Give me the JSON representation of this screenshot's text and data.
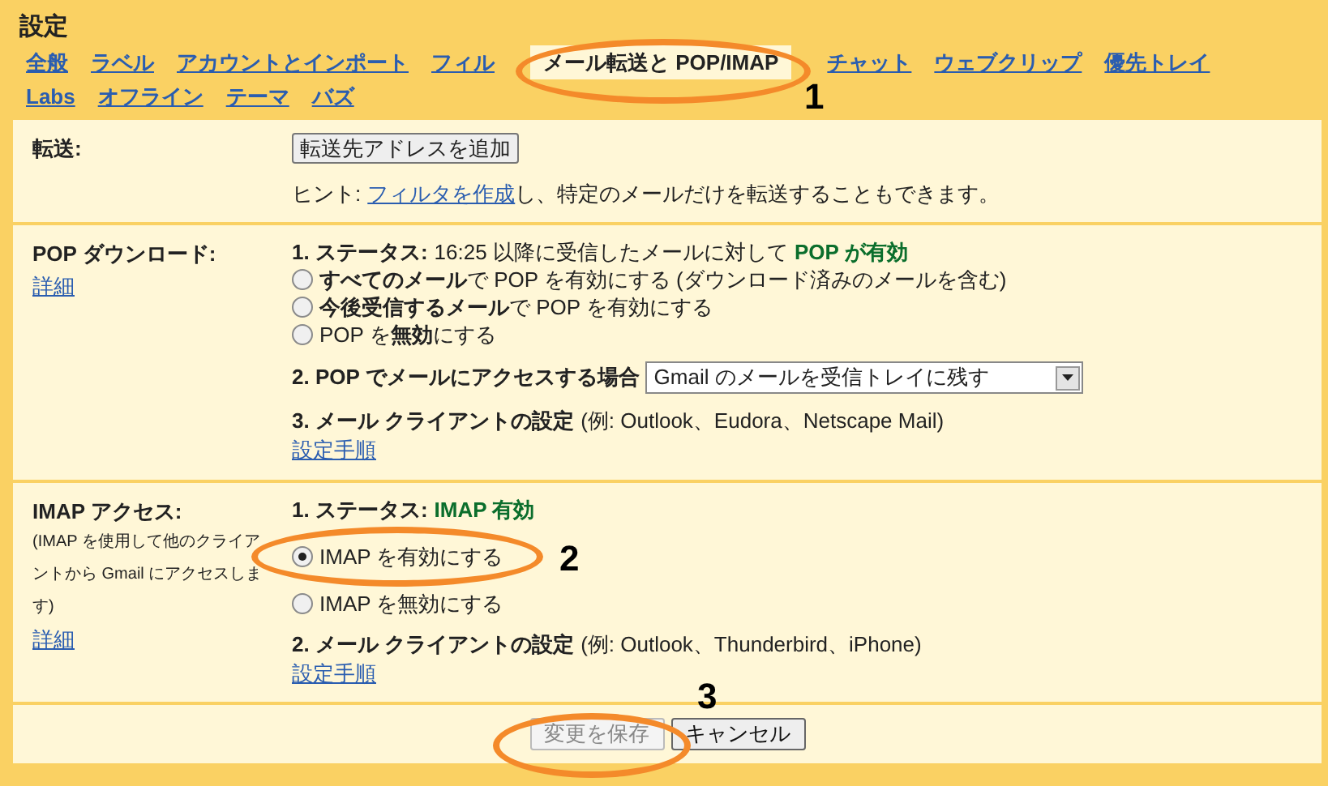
{
  "title": "設定",
  "tabs": [
    {
      "label": "全般",
      "selected": false
    },
    {
      "label": "ラベル",
      "selected": false
    },
    {
      "label": "アカウントとインポート",
      "selected": false
    },
    {
      "label": "フィル",
      "selected": false
    },
    {
      "label": "メール転送と POP/IMAP",
      "selected": true
    },
    {
      "label": "チャット",
      "selected": false
    },
    {
      "label": "ウェブクリップ",
      "selected": false
    },
    {
      "label": "優先トレイ",
      "selected": false
    },
    {
      "label": "Labs",
      "selected": false
    },
    {
      "label": "オフライン",
      "selected": false
    },
    {
      "label": "テーマ",
      "selected": false
    },
    {
      "label": "バズ",
      "selected": false
    }
  ],
  "forwarding": {
    "label": "転送:",
    "button": "転送先アドレスを追加",
    "hint_prefix": "ヒント:",
    "hint_link": "フィルタを作成",
    "hint_suffix": "し、特定のメールだけを転送することもできます。"
  },
  "pop": {
    "label": "POP ダウンロード:",
    "link": "詳細",
    "status_label": "1. ステータス:",
    "status_text": "16:25 以降に受信したメールに対して",
    "status_value": "POP が有効",
    "options": [
      {
        "text": "**すべてのメール**で POP を有効にする (ダウンロード済みのメールを含む)",
        "selected": false
      },
      {
        "text": "**今後受信するメール**で POP を有効にする",
        "selected": false
      },
      {
        "text": "POP を**無効**にする",
        "selected": false
      }
    ],
    "access_label": "2. POP でメールにアクセスする場合",
    "access_value": "Gmail のメールを受信トレイに残す",
    "client_label": "3. メール クライアントの設定",
    "client_text": "(例: Outlook、Eudora、Netscape Mail)",
    "client_link": "設定手順"
  },
  "imap": {
    "label": "IMAP アクセス:",
    "note": "(IMAP を使用して他のクライアントから Gmail にアクセスします)",
    "link": "詳細",
    "status_label": "1. ステータス:",
    "status_value": "IMAP 有効",
    "options": [
      {
        "text": "IMAP を有効にする",
        "selected": true
      },
      {
        "text": "IMAP を無効にする",
        "selected": false
      }
    ],
    "client_label": "2. メール クライアントの設定",
    "client_text": "(例: Outlook、Thunderbird、iPhone)",
    "client_link": "設定手順"
  },
  "actions": [
    {
      "label": "変更を保存",
      "disabled": true
    },
    {
      "label": "キャンセル",
      "disabled": false
    }
  ],
  "annotations": [
    "1",
    "2",
    "3"
  ]
}
